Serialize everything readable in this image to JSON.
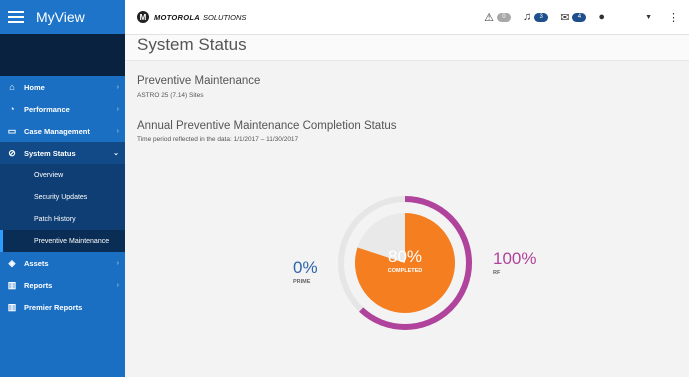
{
  "app": {
    "name": "MyView"
  },
  "brand": {
    "name": "MOTOROLA",
    "suffix": "SOLUTIONS"
  },
  "topbar": {
    "alerts_count": "0",
    "notifications_count": "3",
    "messages_count": "4"
  },
  "sidebar": {
    "items": [
      {
        "label": "Home",
        "icon": "home-icon"
      },
      {
        "label": "Performance",
        "icon": "gauge-icon"
      },
      {
        "label": "Case Management",
        "icon": "case-icon"
      }
    ],
    "system_status": {
      "label": "System Status",
      "icon": "check-circle-icon",
      "sub_items": [
        "Overview",
        "Security Updates",
        "Patch History",
        "Preventive Maintenance"
      ],
      "active": "Preventive Maintenance"
    },
    "bottom_items": [
      {
        "label": "Assets",
        "icon": "diamond-icon"
      },
      {
        "label": "Reports",
        "icon": "bar-chart-icon"
      },
      {
        "label": "Premier Reports",
        "icon": "premier-chart-icon"
      }
    ]
  },
  "page": {
    "title": "System Status",
    "section_title": "Preventive Maintenance",
    "section_subtitle": "ASTRO 25 (7.14) Sites",
    "chart_title": "Annual Preventive Maintenance Completion Status",
    "chart_subtitle": "Time period reflected in the data: 1/1/2017 – 11/30/2017"
  },
  "metrics": {
    "prime_pct": "0%",
    "prime_label": "PRIME",
    "rf_pct": "100%",
    "rf_label": "RF",
    "completed_pct": "80%",
    "completed_label": "COMPLETED"
  },
  "chart_data": {
    "type": "pie",
    "title": "Annual Preventive Maintenance Completion Status",
    "center": {
      "value": 80,
      "label": "COMPLETED"
    },
    "rings": [
      {
        "name": "RF",
        "value": 100,
        "color": "#b0439b"
      },
      {
        "name": "PRIME",
        "value": 0,
        "color": "#2e64ad"
      }
    ],
    "colors": {
      "completed": "#f57f20",
      "track": "#e6e6e6",
      "center_remaining": "#e9e9e9"
    }
  }
}
